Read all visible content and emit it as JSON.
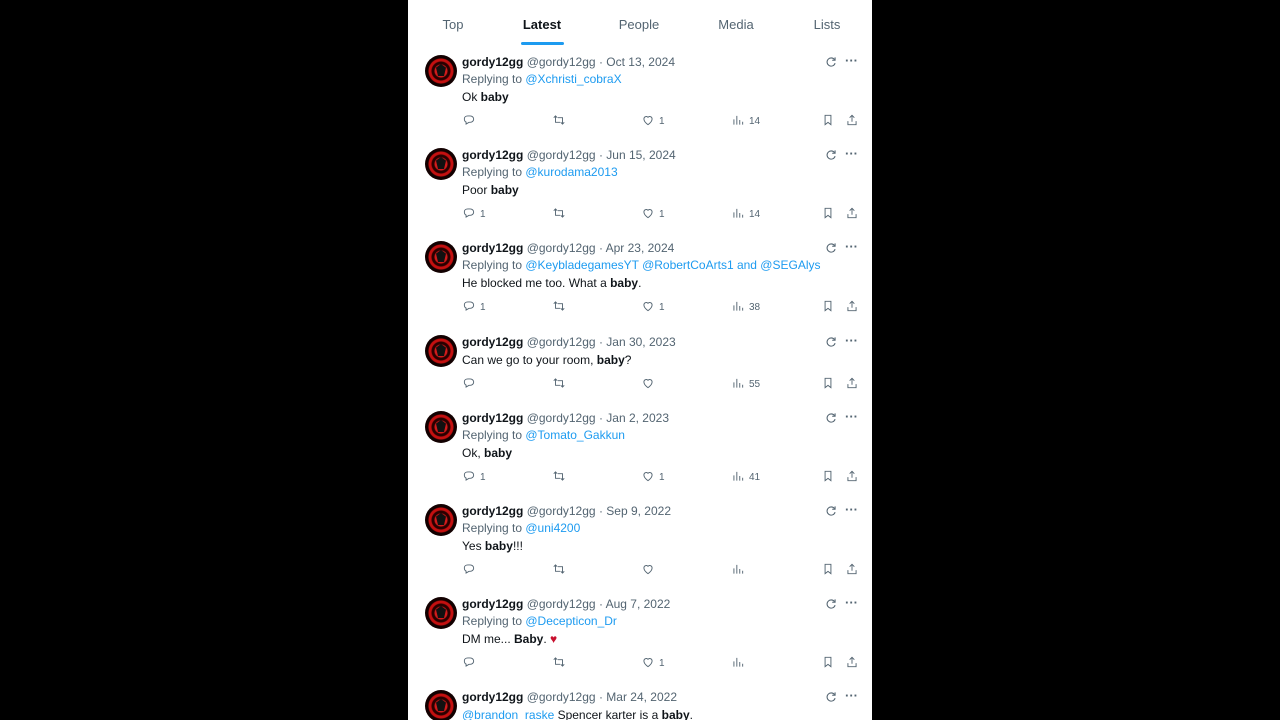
{
  "tabs": [
    {
      "label": "Top"
    },
    {
      "label": "Latest"
    },
    {
      "label": "People"
    },
    {
      "label": "Media"
    },
    {
      "label": "Lists"
    }
  ],
  "active_tab": "Latest",
  "colors": {
    "accent": "#1d9bf0",
    "muted": "#536471",
    "text": "#0f1419"
  },
  "tweets": [
    {
      "name": "gordy12gg",
      "handle": "@gordy12gg",
      "sep": "·",
      "date": "Oct 13, 2024",
      "replying_prefix": "Replying to ",
      "mentions": "@Xchristi_cobraX",
      "text_before": "Ok ",
      "text_bold": "baby",
      "text_after": "",
      "replies": "",
      "retweets": "",
      "likes": "1",
      "views": "14"
    },
    {
      "name": "gordy12gg",
      "handle": "@gordy12gg",
      "sep": "·",
      "date": "Jun 15, 2024",
      "replying_prefix": "Replying to ",
      "mentions": "@kurodama2013",
      "text_before": "Poor ",
      "text_bold": "baby",
      "text_after": "",
      "replies": "1",
      "retweets": "",
      "likes": "1",
      "views": "14"
    },
    {
      "name": "gordy12gg",
      "handle": "@gordy12gg",
      "sep": "·",
      "date": "Apr 23, 2024",
      "replying_prefix": "Replying to ",
      "mentions": "@KeybladegamesYT @RobertCoArts1 and @SEGAlys",
      "text_before": "He blocked me too. What a ",
      "text_bold": "baby",
      "text_after": ".",
      "replies": "1",
      "retweets": "",
      "likes": "1",
      "views": "38"
    },
    {
      "name": "gordy12gg",
      "handle": "@gordy12gg",
      "sep": "·",
      "date": "Jan 30, 2023",
      "replying_prefix": "",
      "mentions": "",
      "text_before": "Can we go to your room, ",
      "text_bold": "baby",
      "text_after": "?",
      "replies": "",
      "retweets": "",
      "likes": "",
      "views": "55"
    },
    {
      "name": "gordy12gg",
      "handle": "@gordy12gg",
      "sep": "·",
      "date": "Jan 2, 2023",
      "replying_prefix": "Replying to ",
      "mentions": "@Tomato_Gakkun",
      "text_before": "Ok, ",
      "text_bold": "baby",
      "text_after": "",
      "replies": "1",
      "retweets": "",
      "likes": "1",
      "views": "41"
    },
    {
      "name": "gordy12gg",
      "handle": "@gordy12gg",
      "sep": "·",
      "date": "Sep 9, 2022",
      "replying_prefix": "Replying to ",
      "mentions": "@uni4200",
      "text_before": "Yes ",
      "text_bold": "baby",
      "text_after": "!!!",
      "replies": "",
      "retweets": "",
      "likes": "",
      "views": ""
    },
    {
      "name": "gordy12gg",
      "handle": "@gordy12gg",
      "sep": "·",
      "date": "Aug 7, 2022",
      "replying_prefix": "Replying to ",
      "mentions": "@Decepticon_Dr",
      "text_before": "DM me... ",
      "text_bold": "Baby",
      "text_after": ". ",
      "emoji": "♥",
      "replies": "",
      "retweets": "",
      "likes": "1",
      "views": ""
    },
    {
      "name": "gordy12gg",
      "handle": "@gordy12gg",
      "sep": "·",
      "date": "Mar 24, 2022",
      "replying_prefix": "",
      "mentions": "@brandon_raske",
      "text_before": " Spencer karter is a ",
      "text_bold": "baby",
      "text_after": ".",
      "replies": "",
      "retweets": "",
      "likes": "",
      "views": ""
    }
  ],
  "icons": {
    "grok": "grok-icon",
    "more": "more-icon",
    "reply": "reply-icon",
    "retweet": "retweet-icon",
    "like": "heart-icon",
    "views": "views-icon",
    "bookmark": "bookmark-icon",
    "share": "share-icon"
  }
}
